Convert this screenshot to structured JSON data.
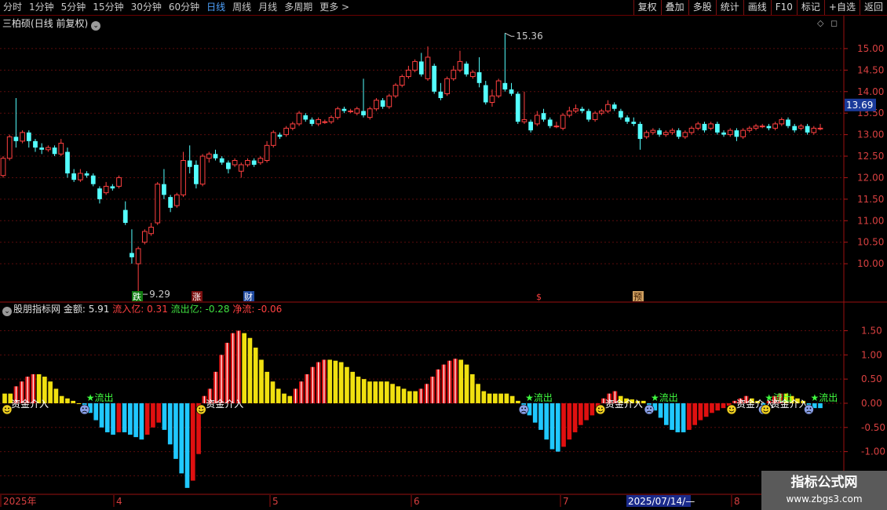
{
  "toolbar": {
    "periods": [
      "分时",
      "1分钟",
      "5分钟",
      "15分钟",
      "30分钟",
      "60分钟",
      "日线",
      "周线",
      "月线",
      "多周期",
      "更多 >"
    ],
    "active_period": "日线",
    "actions": [
      "复权",
      "叠加",
      "多股",
      "统计",
      "画线",
      "F10",
      "标记",
      "+自选",
      "返回"
    ]
  },
  "title": {
    "stock": "三柏硕",
    "mode": "(日线 前复权)"
  },
  "price_axis": {
    "ticks": [
      "15.00",
      "14.50",
      "14.00",
      "13.50",
      "13.00",
      "12.50",
      "12.00",
      "11.50",
      "11.00",
      "10.50",
      "10.00"
    ],
    "current_price": "13.69"
  },
  "indicator": {
    "name": "股朋指标网",
    "amount_label": "金额: ",
    "amount_value": "5.91",
    "inflow_label": "流入亿: ",
    "inflow_value": "0.31",
    "outflow_label": "流出亿: ",
    "outflow_value": "-0.28",
    "net_label": "净流: ",
    "net_value": "-0.06",
    "axis_ticks": [
      "1.50",
      "1.00",
      "0.50",
      "0.00",
      "-0.50",
      "-1.00",
      "-1.50"
    ],
    "in_signal_text": "资金介入",
    "out_signal_text": "★流出"
  },
  "date_axis": {
    "labels": [
      "2025年",
      "4",
      "5",
      "6",
      "7",
      "8"
    ],
    "cursor_date": "2025/07/14/—"
  },
  "markers": {
    "fall": "跌",
    "rise": "涨",
    "finance": "财",
    "dollar": "$",
    "forecast": "预"
  },
  "watermark": {
    "line1": "指标公式网",
    "line2": "www.zbgs3.com"
  },
  "chart_data": {
    "type": "candlestick",
    "ylim": [
      9.2,
      15.4
    ],
    "annotations": {
      "high": "15.36",
      "low": "9.29"
    },
    "candles": [
      [
        12.05,
        12.45,
        12.5,
        12.0
      ],
      [
        12.45,
        12.95,
        13.0,
        12.4
      ],
      [
        12.95,
        12.85,
        13.85,
        12.7
      ],
      [
        12.85,
        13.05,
        13.1,
        12.8
      ],
      [
        13.05,
        12.85,
        13.1,
        12.7
      ],
      [
        12.85,
        12.7,
        12.9,
        12.6
      ],
      [
        12.7,
        12.65,
        12.8,
        12.55
      ],
      [
        12.65,
        12.7,
        12.75,
        12.6
      ],
      [
        12.7,
        12.55,
        12.75,
        12.5
      ],
      [
        12.55,
        12.8,
        12.9,
        12.5
      ],
      [
        12.6,
        12.1,
        12.7,
        12.0
      ],
      [
        12.1,
        11.95,
        12.2,
        11.9
      ],
      [
        11.95,
        12.1,
        12.2,
        11.9
      ],
      [
        12.1,
        12.05,
        12.15,
        12.0
      ],
      [
        12.05,
        11.85,
        12.1,
        11.8
      ],
      [
        11.75,
        11.5,
        11.8,
        11.4
      ],
      [
        11.65,
        11.8,
        11.9,
        11.6
      ],
      [
        11.8,
        11.75,
        11.85,
        11.7
      ],
      [
        11.8,
        12.0,
        12.05,
        11.75
      ],
      [
        11.25,
        10.95,
        11.45,
        10.9
      ],
      [
        10.25,
        10.15,
        10.8,
        10.0
      ],
      [
        10.0,
        10.35,
        10.4,
        9.29
      ],
      [
        10.5,
        10.75,
        10.8,
        10.45
      ],
      [
        10.7,
        10.85,
        10.95,
        10.65
      ],
      [
        10.95,
        11.85,
        11.9,
        10.9
      ],
      [
        11.85,
        11.6,
        12.2,
        11.5
      ],
      [
        11.55,
        11.3,
        11.6,
        11.2
      ],
      [
        11.35,
        11.6,
        11.65,
        11.3
      ],
      [
        11.6,
        12.4,
        12.6,
        11.55
      ],
      [
        12.4,
        12.25,
        12.75,
        12.1
      ],
      [
        12.3,
        11.85,
        12.4,
        11.75
      ],
      [
        11.85,
        12.5,
        12.55,
        11.8
      ],
      [
        12.45,
        12.55,
        12.6,
        12.35
      ],
      [
        12.55,
        12.45,
        12.65,
        12.4
      ],
      [
        12.45,
        12.35,
        12.5,
        12.3
      ],
      [
        12.35,
        12.2,
        12.4,
        12.1
      ],
      [
        12.3,
        12.4,
        12.45,
        12.25
      ],
      [
        12.15,
        12.3,
        12.35,
        12.0
      ],
      [
        12.3,
        12.4,
        12.45,
        12.25
      ],
      [
        12.4,
        12.3,
        12.45,
        12.25
      ],
      [
        12.35,
        12.45,
        12.5,
        12.3
      ],
      [
        12.4,
        12.75,
        12.85,
        12.35
      ],
      [
        12.75,
        13.05,
        13.1,
        12.7
      ],
      [
        13.0,
        12.95,
        13.05,
        12.9
      ],
      [
        13.0,
        13.15,
        13.2,
        12.95
      ],
      [
        13.15,
        13.25,
        13.3,
        13.1
      ],
      [
        13.25,
        13.5,
        13.55,
        13.2
      ],
      [
        13.45,
        13.35,
        13.5,
        13.3
      ],
      [
        13.35,
        13.25,
        13.4,
        13.2
      ],
      [
        13.25,
        13.35,
        13.4,
        13.2
      ],
      [
        13.3,
        13.3,
        13.35,
        13.25
      ],
      [
        13.3,
        13.4,
        13.45,
        13.25
      ],
      [
        13.4,
        13.6,
        13.65,
        13.35
      ],
      [
        13.6,
        13.55,
        13.65,
        13.5
      ],
      [
        13.55,
        13.55,
        13.6,
        13.5
      ],
      [
        13.5,
        13.6,
        13.65,
        13.45
      ],
      [
        13.55,
        13.45,
        14.3,
        13.4
      ],
      [
        13.4,
        13.6,
        13.65,
        13.35
      ],
      [
        13.6,
        13.8,
        13.85,
        13.55
      ],
      [
        13.8,
        13.65,
        13.85,
        13.6
      ],
      [
        13.65,
        13.9,
        13.95,
        13.6
      ],
      [
        13.9,
        14.15,
        14.2,
        13.85
      ],
      [
        14.15,
        14.35,
        14.4,
        14.1
      ],
      [
        14.35,
        14.5,
        14.6,
        14.3
      ],
      [
        14.5,
        14.7,
        14.75,
        14.45
      ],
      [
        14.7,
        14.4,
        14.9,
        14.35
      ],
      [
        14.3,
        14.8,
        15.05,
        14.25
      ],
      [
        14.6,
        14.0,
        14.65,
        13.95
      ],
      [
        14.0,
        13.85,
        14.2,
        13.8
      ],
      [
        13.95,
        14.3,
        14.35,
        13.9
      ],
      [
        14.3,
        14.5,
        14.6,
        14.25
      ],
      [
        14.5,
        14.7,
        14.95,
        14.45
      ],
      [
        14.65,
        14.4,
        14.7,
        14.35
      ],
      [
        14.35,
        14.45,
        14.5,
        14.3
      ],
      [
        14.45,
        14.2,
        14.8,
        14.1
      ],
      [
        14.15,
        13.75,
        14.25,
        13.7
      ],
      [
        13.75,
        13.9,
        14.05,
        13.65
      ],
      [
        13.9,
        14.25,
        14.3,
        13.85
      ],
      [
        14.2,
        14.05,
        15.36,
        14.0
      ],
      [
        14.05,
        13.95,
        14.2,
        13.9
      ],
      [
        13.95,
        13.3,
        14.0,
        13.25
      ],
      [
        13.3,
        13.35,
        14.0,
        13.25
      ],
      [
        13.3,
        13.1,
        13.35,
        13.05
      ],
      [
        13.25,
        13.45,
        13.55,
        13.2
      ],
      [
        13.5,
        13.35,
        13.6,
        13.3
      ],
      [
        13.35,
        13.2,
        13.4,
        13.15
      ],
      [
        13.2,
        13.2,
        13.3,
        13.15
      ],
      [
        13.15,
        13.45,
        13.5,
        13.1
      ],
      [
        13.45,
        13.55,
        13.65,
        13.4
      ],
      [
        13.55,
        13.6,
        13.7,
        13.5
      ],
      [
        13.6,
        13.55,
        13.65,
        13.5
      ],
      [
        13.55,
        13.35,
        13.6,
        13.3
      ],
      [
        13.35,
        13.5,
        13.55,
        13.3
      ],
      [
        13.5,
        13.55,
        13.6,
        13.45
      ],
      [
        13.55,
        13.7,
        13.8,
        13.5
      ],
      [
        13.7,
        13.6,
        13.75,
        13.55
      ],
      [
        13.55,
        13.4,
        13.6,
        13.35
      ],
      [
        13.4,
        13.3,
        13.45,
        13.25
      ],
      [
        13.3,
        13.25,
        13.4,
        13.2
      ],
      [
        13.25,
        12.9,
        13.3,
        12.65
      ],
      [
        12.95,
        13.05,
        13.1,
        12.9
      ],
      [
        13.05,
        13.1,
        13.15,
        13.0
      ],
      [
        13.1,
        13.0,
        13.15,
        12.95
      ],
      [
        13.0,
        13.05,
        13.1,
        12.95
      ],
      [
        13.05,
        13.1,
        13.15,
        13.0
      ],
      [
        13.1,
        12.95,
        13.15,
        12.9
      ],
      [
        12.95,
        13.05,
        13.1,
        12.9
      ],
      [
        13.05,
        13.15,
        13.2,
        13.0
      ],
      [
        13.15,
        13.25,
        13.3,
        13.1
      ],
      [
        13.25,
        13.1,
        13.3,
        13.05
      ],
      [
        13.15,
        13.25,
        13.3,
        13.1
      ],
      [
        13.25,
        13.05,
        13.3,
        13.0
      ],
      [
        13.05,
        13.0,
        13.1,
        12.95
      ],
      [
        13.0,
        13.1,
        13.15,
        12.95
      ],
      [
        13.1,
        12.95,
        13.15,
        12.85
      ],
      [
        12.95,
        13.1,
        13.15,
        12.9
      ],
      [
        13.1,
        13.15,
        13.2,
        13.05
      ],
      [
        13.15,
        13.2,
        13.25,
        13.1
      ],
      [
        13.2,
        13.2,
        13.25,
        13.15
      ],
      [
        13.2,
        13.15,
        13.25,
        13.1
      ],
      [
        13.15,
        13.25,
        13.3,
        13.1
      ],
      [
        13.25,
        13.35,
        13.4,
        13.2
      ],
      [
        13.35,
        13.2,
        13.4,
        13.15
      ],
      [
        13.2,
        13.1,
        13.25,
        13.05
      ],
      [
        13.15,
        13.2,
        13.25,
        13.1
      ],
      [
        13.2,
        13.05,
        13.25,
        13.0
      ],
      [
        13.05,
        13.15,
        13.2,
        13.0
      ],
      [
        13.15,
        13.15,
        13.25,
        13.1
      ]
    ],
    "flow_ylim": [
      -1.85,
      1.8
    ],
    "flow": [
      0.2,
      0.2,
      0.35,
      0.45,
      0.55,
      0.6,
      0.6,
      0.55,
      0.45,
      0.3,
      0.15,
      0.1,
      0.05,
      0.0,
      -0.05,
      -0.2,
      -0.35,
      -0.5,
      -0.6,
      -0.65,
      -0.6,
      -0.6,
      -0.65,
      -0.7,
      -0.75,
      -0.65,
      -0.5,
      -0.4,
      -0.55,
      -0.85,
      -1.15,
      -1.45,
      -1.75,
      -1.6,
      -1.05,
      0.15,
      0.3,
      0.65,
      1.0,
      1.25,
      1.45,
      1.5,
      1.45,
      1.35,
      1.15,
      0.9,
      0.65,
      0.45,
      0.3,
      0.2,
      0.15,
      0.3,
      0.45,
      0.6,
      0.75,
      0.85,
      0.9,
      0.9,
      0.88,
      0.85,
      0.75,
      0.65,
      0.55,
      0.5,
      0.45,
      0.45,
      0.45,
      0.45,
      0.4,
      0.35,
      0.3,
      0.25,
      0.25,
      0.3,
      0.4,
      0.55,
      0.7,
      0.8,
      0.88,
      0.92,
      0.9,
      0.8,
      0.6,
      0.4,
      0.25,
      0.2,
      0.2,
      0.2,
      0.2,
      0.15,
      0.05,
      -0.1,
      -0.25,
      -0.4,
      -0.55,
      -0.75,
      -0.95,
      -1.0,
      -0.9,
      -0.75,
      -0.6,
      -0.45,
      -0.35,
      -0.25,
      -0.15,
      0.1,
      0.2,
      0.25,
      0.15,
      0.1,
      0.08,
      0.05,
      0.05,
      -0.05,
      -0.15,
      -0.3,
      -0.45,
      -0.55,
      -0.6,
      -0.6,
      -0.55,
      -0.45,
      -0.35,
      -0.28,
      -0.2,
      -0.15,
      -0.1,
      -0.05,
      0.05,
      0.1,
      0.15,
      0.1,
      0.05,
      -0.05,
      0.05,
      0.15,
      0.2,
      0.2,
      0.15,
      0.1,
      0.05,
      -0.05,
      -0.1,
      -0.1
    ]
  }
}
